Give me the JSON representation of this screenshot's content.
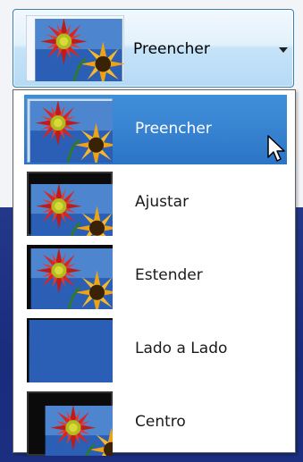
{
  "combo": {
    "selected_label": "Preencher",
    "icon": "chevron-down-icon"
  },
  "options": [
    {
      "label": "Preencher",
      "mode": "fill",
      "selected": true
    },
    {
      "label": "Ajustar",
      "mode": "fit",
      "selected": false
    },
    {
      "label": "Estender",
      "mode": "stretch",
      "selected": false
    },
    {
      "label": "Lado a Lado",
      "mode": "tile",
      "selected": false
    },
    {
      "label": "Centro",
      "mode": "center",
      "selected": false
    }
  ],
  "colors": {
    "selection": "#3a86d3",
    "desktop_background": "#1c2f7e",
    "combo_border": "#3c7fb1"
  }
}
